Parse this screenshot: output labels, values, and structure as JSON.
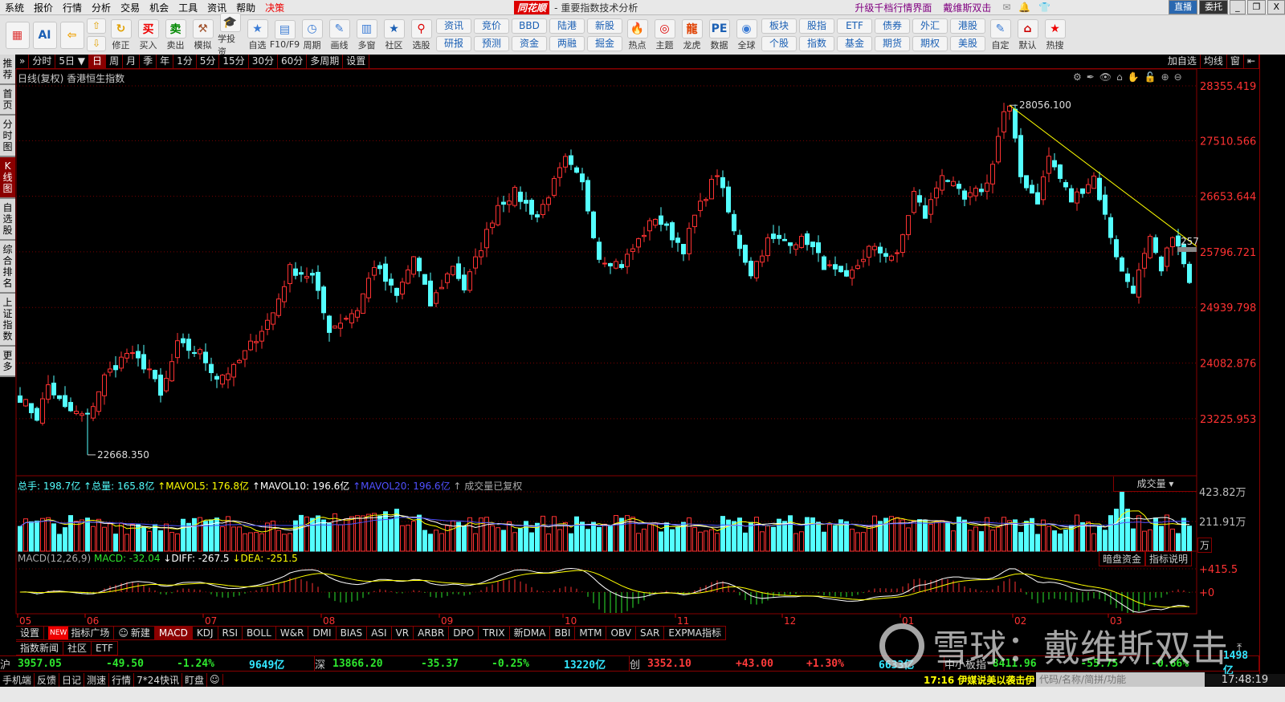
{
  "menu": {
    "items": [
      "系统",
      "报价",
      "行情",
      "分析",
      "交易",
      "机会",
      "工具",
      "资讯",
      "帮助"
    ],
    "highlight_item": "决策",
    "logo": "同花顺",
    "title": "- 重要指数技术分析",
    "promo1": "升级千档行情界面",
    "promo2": "戴维斯双击",
    "live_button": "直播",
    "entrust_button": "委托",
    "minimize": "_",
    "restore": "❐",
    "close": "X"
  },
  "toolbar": {
    "left_buttons": [
      {
        "name": "modules",
        "icon": "▦",
        "color": "#d33"
      },
      {
        "name": "ai",
        "icon": "AI",
        "color": "#1a5fb4"
      },
      {
        "name": "back",
        "icon": "⇦",
        "color": "#f0a000"
      }
    ],
    "items": [
      {
        "label": "修正",
        "icon": "↻",
        "color": "#e0a000"
      },
      {
        "label": "买入",
        "icon": "买",
        "color": "#e00"
      },
      {
        "label": "卖出",
        "icon": "卖",
        "color": "#080"
      },
      {
        "label": "模拟",
        "icon": "⚒",
        "color": "#a0522d"
      },
      {
        "label": "学投资",
        "icon": "🎓",
        "color": "#3a7bd5"
      },
      {
        "label": "自选",
        "icon": "★",
        "color": "#3a7bd5"
      },
      {
        "label": "F10/F9",
        "icon": "▤",
        "color": "#3a7bd5"
      },
      {
        "label": "周期",
        "icon": "◷",
        "color": "#3a7bd5"
      },
      {
        "label": "画线",
        "icon": "✎",
        "color": "#3a7bd5"
      },
      {
        "label": "多窗",
        "icon": "▥",
        "color": "#3a7bd5"
      },
      {
        "label": "社区",
        "icon": "★",
        "color": "#1a5fb4"
      },
      {
        "label": "选股",
        "icon": "⚲",
        "color": "#d00"
      }
    ],
    "pairs1": [
      [
        "资讯",
        "研报"
      ],
      [
        "竞价",
        "预测"
      ],
      [
        "BBD",
        "资金"
      ],
      [
        "陆港",
        "两融"
      ],
      [
        "新股",
        "掘金"
      ]
    ],
    "items2": [
      {
        "label": "热点",
        "icon": "🔥",
        "color": "#e00"
      },
      {
        "label": "主题",
        "icon": "◎",
        "color": "#d00"
      },
      {
        "label": "龙虎",
        "icon": "龍",
        "color": "#e04000"
      },
      {
        "label": "数据",
        "icon": "PE",
        "color": "#1a5fb4"
      },
      {
        "label": "全球",
        "icon": "◉",
        "color": "#3a7bd5"
      }
    ],
    "pairs2": [
      [
        "板块",
        "个股"
      ],
      [
        "股指",
        "指数"
      ],
      [
        "ETF",
        "基金"
      ],
      [
        "债券",
        "期货"
      ],
      [
        "外汇",
        "期权"
      ],
      [
        "港股",
        "美股"
      ]
    ],
    "items3": [
      {
        "label": "自定",
        "icon": "✎",
        "color": "#3a7bd5"
      },
      {
        "label": "默认",
        "icon": "⌂",
        "color": "#c00"
      },
      {
        "label": "热搜",
        "icon": "★",
        "color": "#e00"
      }
    ]
  },
  "leftnav": [
    "推荐",
    "首页",
    "分时图",
    "K线图",
    "自选股",
    "综合排名",
    "上证指数",
    "更多"
  ],
  "leftnav_active": "K线图",
  "periodbar": {
    "expand": "»",
    "items": [
      "分时",
      "5日 ▼",
      "日",
      "周",
      "月",
      "季",
      "年",
      "1分",
      "5分",
      "15分",
      "30分",
      "60分",
      "多周期",
      "设置"
    ],
    "active": "日",
    "right": [
      "加自选",
      "均线",
      "窗",
      "⇤"
    ]
  },
  "main_chart": {
    "title": "日线(复权) 香港恒生指数",
    "tools": [
      "⚙",
      "✒",
      "👁",
      "⌂",
      "✋",
      "🔓",
      "⊕",
      "⊖"
    ],
    "current_label": "257",
    "current_price": 25833
  },
  "volume_header": {
    "total_hands": "总手: 198.7亿",
    "total_volume": "↑总量: 165.8亿",
    "mavol5": "↑MAVOL5: 176.8亿",
    "mavol10": "↑MAVOL10: 196.6亿",
    "mavol20": "↑MAVOL20: 196.6亿",
    "note": "↑ 成交量已复权",
    "selector": "成交量 ▾",
    "unit": "万"
  },
  "macd_header": {
    "name": "MACD(12,26,9)",
    "macd": "MACD: -32.04",
    "diff": "↓DIFF: -267.5",
    "dea": "↓DEA: -251.5",
    "btn_hidden_funds": "暗盘资金",
    "btn_explain": "指标说明"
  },
  "chart_data": {
    "type": "candlestick",
    "title": "日线(复权) 香港恒生指数",
    "y_ticks": [
      "28355.419",
      "27510.566",
      "26653.644",
      "25796.721",
      "24939.798",
      "24082.876",
      "23225.953"
    ],
    "ylim": [
      22490,
      28355.419
    ],
    "annotations": {
      "high": "28056.100",
      "low": "22668.350",
      "high_idx": 176,
      "low_idx": 12
    },
    "n_candles": 209,
    "close_keypoints": [
      [
        0,
        23557
      ],
      [
        3,
        23248
      ],
      [
        5,
        23743
      ],
      [
        8,
        23372
      ],
      [
        12,
        23248
      ],
      [
        15,
        23867
      ],
      [
        19,
        24237
      ],
      [
        23,
        23990
      ],
      [
        25,
        23557
      ],
      [
        28,
        24361
      ],
      [
        32,
        24237
      ],
      [
        35,
        23867
      ],
      [
        38,
        23990
      ],
      [
        41,
        24361
      ],
      [
        45,
        24856
      ],
      [
        48,
        25536
      ],
      [
        52,
        25412
      ],
      [
        54,
        24856
      ],
      [
        55,
        24608
      ],
      [
        60,
        24918
      ],
      [
        63,
        25598
      ],
      [
        67,
        25103
      ],
      [
        70,
        25721
      ],
      [
        73,
        24979
      ],
      [
        77,
        25598
      ],
      [
        79,
        25227
      ],
      [
        83,
        26092
      ],
      [
        85,
        26525
      ],
      [
        88,
        26710
      ],
      [
        92,
        26340
      ],
      [
        97,
        27205
      ],
      [
        100,
        26834
      ],
      [
        103,
        25721
      ],
      [
        107,
        25598
      ],
      [
        110,
        25969
      ],
      [
        113,
        26340
      ],
      [
        118,
        25845
      ],
      [
        120,
        26340
      ],
      [
        124,
        27020
      ],
      [
        127,
        26092
      ],
      [
        130,
        25474
      ],
      [
        133,
        25969
      ],
      [
        136,
        25969
      ],
      [
        140,
        25969
      ],
      [
        143,
        25598
      ],
      [
        147,
        25350
      ],
      [
        151,
        25845
      ],
      [
        156,
        25721
      ],
      [
        159,
        26710
      ],
      [
        161,
        26340
      ],
      [
        164,
        27020
      ],
      [
        168,
        26587
      ],
      [
        172,
        26834
      ],
      [
        175,
        27947
      ],
      [
        176,
        28000
      ],
      [
        178,
        26958
      ],
      [
        181,
        26587
      ],
      [
        183,
        27267
      ],
      [
        187,
        26587
      ],
      [
        191,
        26958
      ],
      [
        193,
        26340
      ],
      [
        196,
        25474
      ],
      [
        198,
        25227
      ],
      [
        201,
        25969
      ],
      [
        203,
        25474
      ],
      [
        205,
        26092
      ],
      [
        207,
        25598
      ],
      [
        208,
        25288
      ]
    ],
    "trendline": [
      [
        176,
        28056.1
      ],
      [
        208,
        25880
      ]
    ],
    "months": [
      {
        "label": "05",
        "idx": 0
      },
      {
        "label": "06",
        "idx": 12
      },
      {
        "label": "07",
        "idx": 33
      },
      {
        "label": "08",
        "idx": 54
      },
      {
        "label": "09",
        "idx": 75
      },
      {
        "label": "10",
        "idx": 97
      },
      {
        "label": "11",
        "idx": 117
      },
      {
        "label": "12",
        "idx": 136
      },
      {
        "label": "01",
        "idx": 157
      },
      {
        "label": "02",
        "idx": 177
      },
      {
        "label": "03",
        "idx": 194
      }
    ],
    "volume_ticks": [
      "423.82万",
      "211.91万"
    ],
    "volume_max": 423.82,
    "macd_ticks": [
      "+415.5",
      "+0"
    ],
    "macd_top": 415.5
  },
  "indicator_tabs": {
    "settings": "设置",
    "new_badge": "NEW",
    "plaza": "指标广场",
    "new": "新建",
    "items": [
      "MACD",
      "KDJ",
      "RSI",
      "BOLL",
      "W&R",
      "DMI",
      "BIAS",
      "ASI",
      "VR",
      "ARBR",
      "DPO",
      "TRIX",
      "新DMA",
      "BBI",
      "MTM",
      "OBV",
      "SAR",
      "EXPMA指标"
    ],
    "active": "MACD"
  },
  "news_tabs": [
    "指数新闻",
    "社区",
    "ETF"
  ],
  "watermark": "雪球：戴维斯双击",
  "indices": [
    {
      "name": "沪",
      "value": "3957.05",
      "change": "-49.50",
      "pct": "-1.24%",
      "amount": "9649亿",
      "dir": "down"
    },
    {
      "name": "深",
      "value": "13866.20",
      "change": "-35.37",
      "pct": "-0.25%",
      "amount": "13220亿",
      "dir": "down"
    },
    {
      "name": "创",
      "value": "3352.10",
      "change": "+43.00",
      "pct": "+1.30%",
      "amount": "6633亿",
      "dir": "up"
    },
    {
      "name": "中小板指",
      "value": "8411.96",
      "change": "-55.75",
      "pct": "-0.66%",
      "amount": "1498亿",
      "dir": "down"
    }
  ],
  "statusbar": {
    "items": [
      "手机端",
      "反馈",
      "日记",
      "测速",
      "行情",
      "7*24快讯",
      "盯盘"
    ],
    "news": "17:16 伊媒说美以袭击伊",
    "search_placeholder": "代码/名称/简拼/功能",
    "time": "17:48:19"
  },
  "colors": {
    "up": "#ff3232",
    "down": "#54ffff",
    "grid": "#7a0000",
    "axis": "#ff3232",
    "trend": "#ffff00"
  }
}
